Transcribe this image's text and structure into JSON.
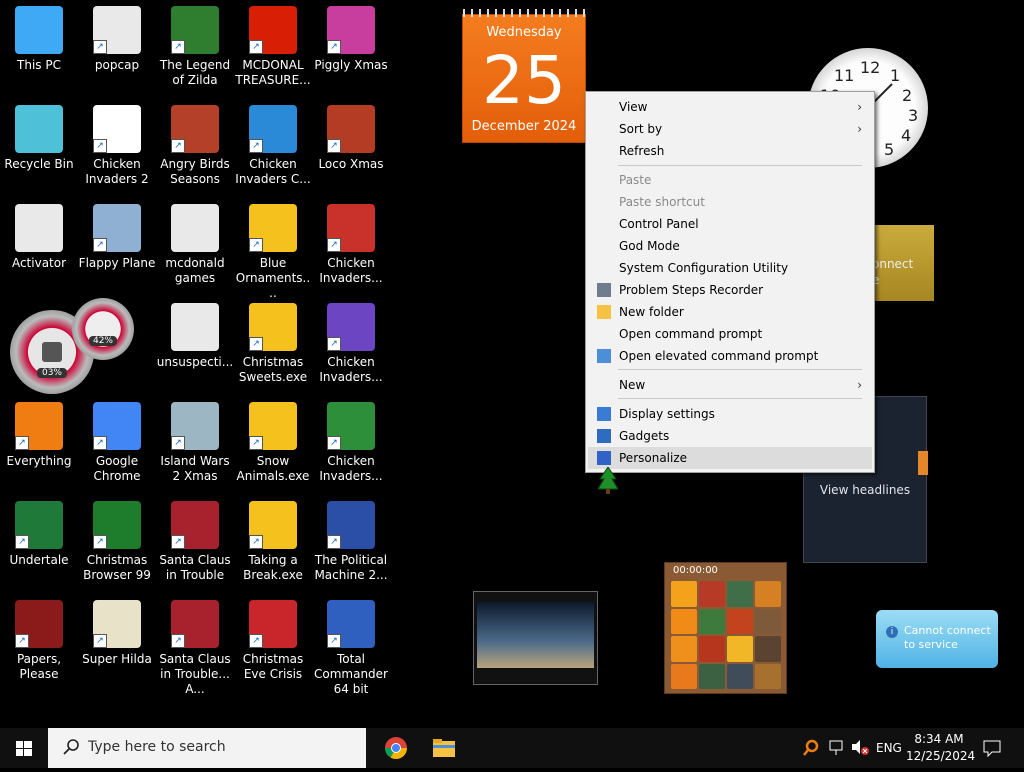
{
  "desktop": {
    "icons": [
      {
        "label": "This PC",
        "name": "this-pc-icon",
        "color": "#3fa9f5",
        "short": false
      },
      {
        "label": "popcap",
        "name": "folder-icon",
        "color": "#e9e9e9",
        "short": true
      },
      {
        "label": "The Legend of Zilda",
        "name": "game-legend-of-zilda-icon",
        "color": "#2f7d2f",
        "short": true
      },
      {
        "label": "MCDONAL TREASURE...",
        "name": "game-mcdonald-icon",
        "color": "#d81e05",
        "short": true
      },
      {
        "label": "Piggly Xmas",
        "name": "game-piggly-icon",
        "color": "#c83e9f",
        "short": true
      },
      {
        "label": "Recycle Bin",
        "name": "recycle-bin-icon",
        "color": "#4ec0d8",
        "short": false
      },
      {
        "label": "Chicken Invaders 2",
        "name": "game-chicken-invaders-2-icon",
        "color": "#ffffff",
        "short": true
      },
      {
        "label": "Angry Birds Seasons",
        "name": "game-angry-birds-icon",
        "color": "#b5402a",
        "short": true
      },
      {
        "label": "Chicken Invaders C...",
        "name": "game-chicken-invaders-c-icon",
        "color": "#2a8ad8",
        "short": true
      },
      {
        "label": "Loco Xmas",
        "name": "game-loco-xmas-icon",
        "color": "#b43c24",
        "short": true
      },
      {
        "label": "Activator",
        "name": "folder-activator-icon",
        "color": "#e9e9e9",
        "short": false
      },
      {
        "label": "Flappy Plane",
        "name": "game-flappy-plane-icon",
        "color": "#8fb0d3",
        "short": true
      },
      {
        "label": "mcdonald games",
        "name": "folder-mcdonald-games-icon",
        "color": "#e9e9e9",
        "short": false
      },
      {
        "label": "Blue Ornaments....",
        "name": "blue-ornaments-icon",
        "color": "#f5c11c",
        "short": true
      },
      {
        "label": "Chicken Invaders...",
        "name": "game-chicken-invaders-3-icon",
        "color": "#c9312b",
        "short": true
      },
      {
        "label": "",
        "name": "spacer",
        "color": "transparent",
        "short": false
      },
      {
        "label": "",
        "name": "spacer",
        "color": "transparent",
        "short": false
      },
      {
        "label": "unsuspecti...",
        "name": "file-unsuspecting-icon",
        "color": "#e9e9e9",
        "short": false
      },
      {
        "label": "Christmas Sweets.exe",
        "name": "christmas-sweets-icon",
        "color": "#f5c11c",
        "short": true
      },
      {
        "label": "Chicken Invaders...",
        "name": "game-chicken-invaders-4-icon",
        "color": "#6c46c2",
        "short": true
      },
      {
        "label": "Everything",
        "name": "everything-search-icon",
        "color": "#f07d12",
        "short": true
      },
      {
        "label": "Google Chrome",
        "name": "chrome-icon",
        "color": "#4285f4",
        "short": true
      },
      {
        "label": "Island Wars 2 Xmas",
        "name": "game-island-wars-icon",
        "color": "#9db6c4",
        "short": true
      },
      {
        "label": "Snow Animals.exe",
        "name": "snow-animals-icon",
        "color": "#f5c11c",
        "short": true
      },
      {
        "label": "Chicken Invaders...",
        "name": "game-chicken-invaders-5-icon",
        "color": "#2e8f3a",
        "short": true
      },
      {
        "label": "Undertale",
        "name": "game-undertale-icon",
        "color": "#1f7a3a",
        "short": true
      },
      {
        "label": "Christmas Browser 99",
        "name": "christmas-browser-icon",
        "color": "#1d7d2c",
        "short": true
      },
      {
        "label": "Santa Claus in Trouble",
        "name": "game-santa-trouble-icon",
        "color": "#a8222e",
        "short": true
      },
      {
        "label": "Taking a Break.exe",
        "name": "taking-a-break-icon",
        "color": "#f5c11c",
        "short": true
      },
      {
        "label": "The Political Machine 2...",
        "name": "game-political-machine-icon",
        "color": "#2b4ea6",
        "short": true
      },
      {
        "label": "Papers, Please",
        "name": "game-papers-please-icon",
        "color": "#8b1a1a",
        "short": true
      },
      {
        "label": "Super Hilda",
        "name": "game-super-hilda-icon",
        "color": "#e8e2c8",
        "short": true
      },
      {
        "label": "Santa Claus in Trouble... A...",
        "name": "game-santa-trouble-2-icon",
        "color": "#a8222e",
        "short": true
      },
      {
        "label": "Christmas Eve Crisis",
        "name": "game-christmas-eve-crisis-icon",
        "color": "#c8262a",
        "short": true
      },
      {
        "label": "Total Commander 64 bit",
        "name": "total-commander-icon",
        "color": "#2f5fbf",
        "short": true
      }
    ]
  },
  "gadgets": {
    "calendar": {
      "weekday": "Wednesday",
      "day": "25",
      "month_year": "December 2024"
    },
    "clock": {
      "n12": "12",
      "n1": "1",
      "n2": "2",
      "n3": "3",
      "n4": "4",
      "n5": "5",
      "n10": "10",
      "n11": "11"
    },
    "feed": {
      "line1": "onnect",
      "line2": "e"
    },
    "news": {
      "view_headlines": "View headlines"
    },
    "cpu_meter": {
      "cpu": "03%",
      "mem": "42%"
    },
    "puzzle": {
      "time": "00:00:00"
    },
    "weather": {
      "line1": "Cannot connect",
      "line2": "to service",
      "info_icon": "i"
    }
  },
  "context_menu": {
    "items": [
      {
        "label": "View",
        "submenu": true,
        "disabled": false
      },
      {
        "label": "Sort by",
        "submenu": true,
        "disabled": false
      },
      {
        "label": "Refresh",
        "submenu": false,
        "disabled": false
      },
      {
        "label": "Paste",
        "submenu": false,
        "disabled": true
      },
      {
        "label": "Paste shortcut",
        "submenu": false,
        "disabled": true
      },
      {
        "label": "Control Panel",
        "submenu": false,
        "disabled": false
      },
      {
        "label": "God Mode",
        "submenu": false,
        "disabled": false
      },
      {
        "label": "System Configuration Utility",
        "submenu": false,
        "disabled": false
      },
      {
        "label": "Problem Steps Recorder",
        "submenu": false,
        "disabled": false
      },
      {
        "label": "New folder",
        "submenu": false,
        "disabled": false
      },
      {
        "label": "Open command prompt",
        "submenu": false,
        "disabled": false
      },
      {
        "label": "Open elevated command prompt",
        "submenu": false,
        "disabled": false
      },
      {
        "label": "New",
        "submenu": true,
        "disabled": false
      },
      {
        "label": "Display settings",
        "submenu": false,
        "disabled": false
      },
      {
        "label": "Gadgets",
        "submenu": false,
        "disabled": false
      },
      {
        "label": "Personalize",
        "submenu": false,
        "disabled": false,
        "highlighted": true
      }
    ],
    "chevron": "›"
  },
  "taskbar": {
    "search_placeholder": "Type here to search",
    "language": "ENG",
    "time": "8:34 AM",
    "date": "12/25/2024"
  }
}
